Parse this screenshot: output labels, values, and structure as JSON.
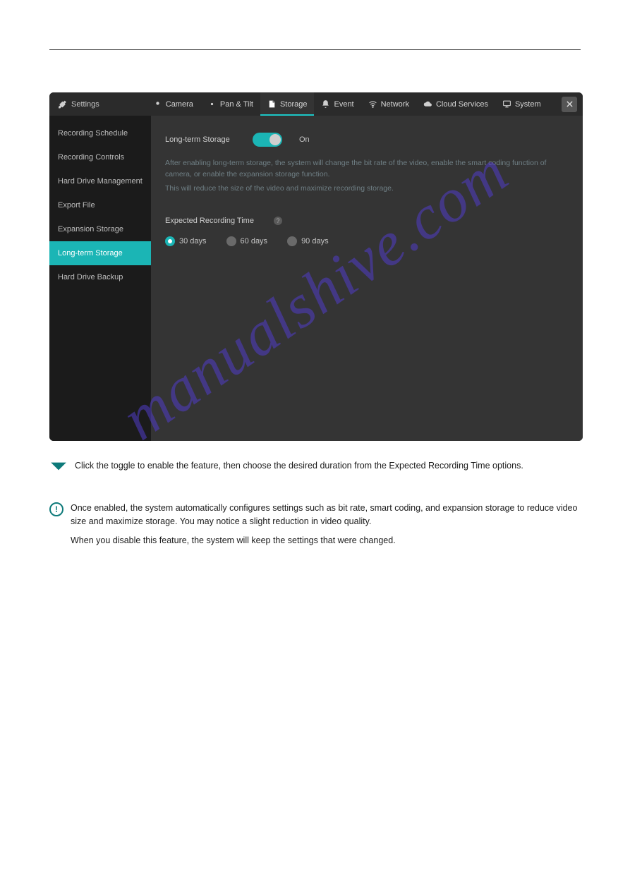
{
  "titlebar": {
    "title": "Settings"
  },
  "tabs": {
    "camera": "Camera",
    "pantilt": "Pan & Tilt",
    "storage": "Storage",
    "event": "Event",
    "network": "Network",
    "cloud": "Cloud Services",
    "system": "System"
  },
  "sidebar": {
    "items": [
      "Recording Schedule",
      "Recording Controls",
      "Hard Drive Management",
      "Export File",
      "Expansion Storage",
      "Long-term Storage",
      "Hard Drive Backup"
    ]
  },
  "content": {
    "long_term_label": "Long-term Storage",
    "on_label": "On",
    "desc1": "After enabling long-term storage, the system will change the bit rate of the video, enable the smart coding function of camera, or enable the expansion storage function.",
    "desc2": "This will reduce the size of the video and maximize recording storage.",
    "expected_label": "Expected Recording Time",
    "options": {
      "d30": "30 days",
      "d60": "60 days",
      "d90": "90 days"
    }
  },
  "doc": {
    "step": "Click the toggle to enable the feature, then choose the desired duration from the Expected Recording Time options.",
    "notice1": "Once enabled, the system automatically configures settings such as bit rate, smart coding, and expansion storage to reduce video size and maximize storage. You may notice a slight reduction in video quality.",
    "notice2": "When you disable this feature, the system will keep the settings that were changed."
  },
  "watermark": "manualshive.com"
}
